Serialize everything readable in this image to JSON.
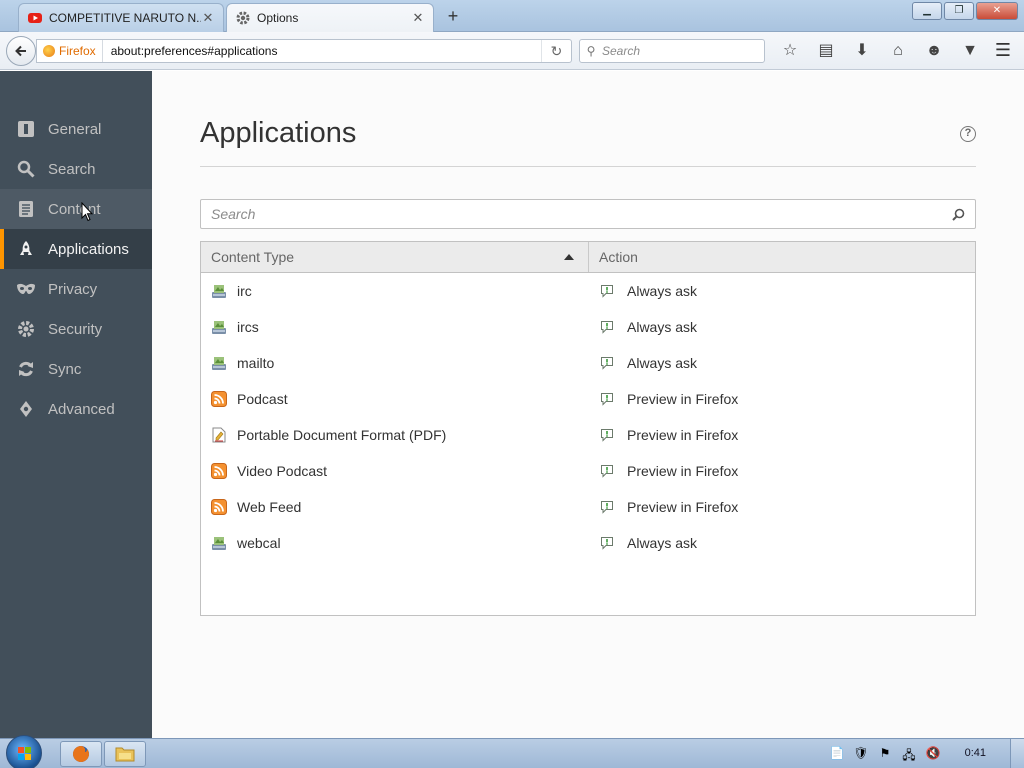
{
  "browser": {
    "tabs": [
      {
        "label": "COMPETITIVE NARUTO N...",
        "icon": "youtube-icon",
        "active": false
      },
      {
        "label": "Options",
        "icon": "gear-icon",
        "active": true
      }
    ],
    "url_identity": "Firefox",
    "url": "about:preferences#applications",
    "search_placeholder": "Search",
    "toolbar_icons": [
      "bookmark-star-icon",
      "reading-list-icon",
      "download-icon",
      "home-icon",
      "hello-icon",
      "pocket-icon"
    ]
  },
  "sidebar": {
    "items": [
      {
        "label": "General",
        "icon": "general-icon"
      },
      {
        "label": "Search",
        "icon": "search-icon"
      },
      {
        "label": "Content",
        "icon": "content-icon"
      },
      {
        "label": "Applications",
        "icon": "applications-icon"
      },
      {
        "label": "Privacy",
        "icon": "privacy-mask-icon"
      },
      {
        "label": "Security",
        "icon": "security-icon"
      },
      {
        "label": "Sync",
        "icon": "sync-icon"
      },
      {
        "label": "Advanced",
        "icon": "advanced-icon"
      }
    ],
    "active": "Applications"
  },
  "main": {
    "title": "Applications",
    "filter_placeholder": "Search",
    "table": {
      "columns": [
        "Content Type",
        "Action"
      ],
      "rows": [
        {
          "type": "irc",
          "icon": "app-icon",
          "action": "Always ask"
        },
        {
          "type": "ircs",
          "icon": "app-icon",
          "action": "Always ask"
        },
        {
          "type": "mailto",
          "icon": "app-icon",
          "action": "Always ask"
        },
        {
          "type": "Podcast",
          "icon": "feed-icon",
          "action": "Preview in Firefox"
        },
        {
          "type": "Portable Document Format (PDF)",
          "icon": "pdf-icon",
          "action": "Preview in Firefox"
        },
        {
          "type": "Video Podcast",
          "icon": "feed-icon",
          "action": "Preview in Firefox"
        },
        {
          "type": "Web Feed",
          "icon": "feed-icon",
          "action": "Preview in Firefox"
        },
        {
          "type": "webcal",
          "icon": "app-icon",
          "action": "Always ask"
        }
      ]
    }
  },
  "taskbar": {
    "clock": "0:41"
  },
  "colors": {
    "sidebar_bg": "#424f5a",
    "active_accent": "#ff9500"
  }
}
